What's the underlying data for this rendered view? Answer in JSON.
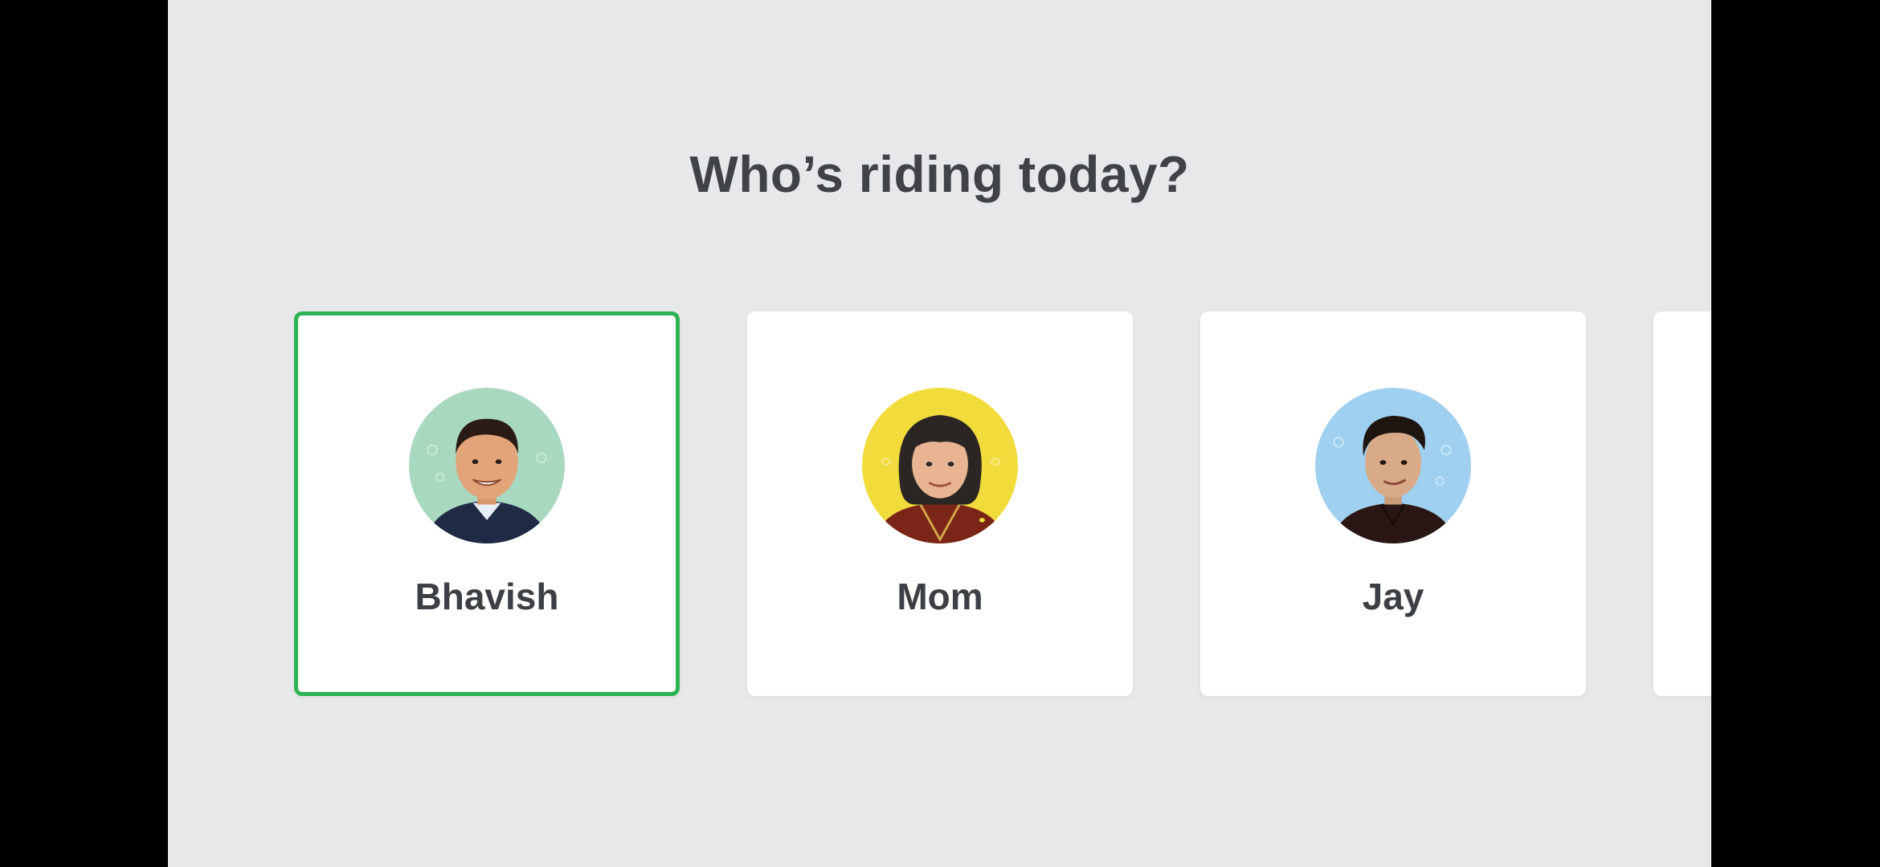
{
  "prompt": {
    "title": "Who’s riding today?"
  },
  "profiles": [
    {
      "name": "Bhavish",
      "avatar_icon": "person-avatar-icon",
      "avatar_bg": "#a8d8c0",
      "selected": true
    },
    {
      "name": "Mom",
      "avatar_icon": "person-avatar-icon",
      "avatar_bg": "#f2dc3c",
      "selected": false
    },
    {
      "name": "Jay",
      "avatar_icon": "person-avatar-icon",
      "avatar_bg": "#9fd0f0",
      "selected": false
    },
    {
      "name": "",
      "selected": false
    }
  ],
  "colors": {
    "background": "#e7e8e9",
    "card": "#ffffff",
    "selected_border": "#2db354",
    "text": "#3f4347"
  }
}
